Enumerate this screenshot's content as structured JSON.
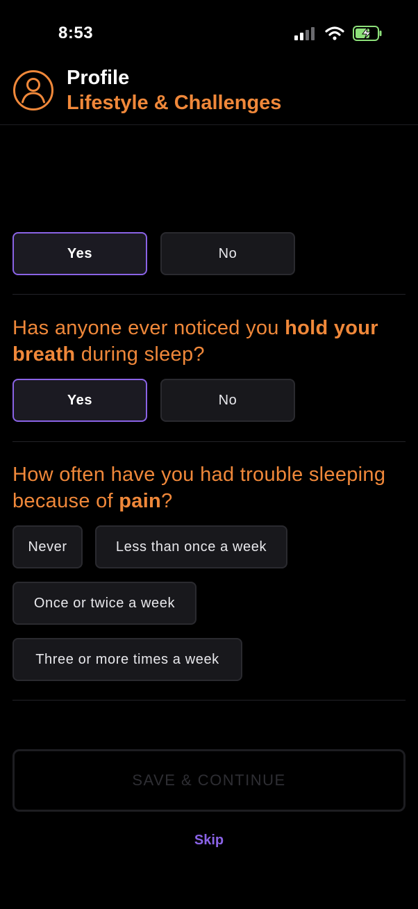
{
  "status_bar": {
    "time": "8:53"
  },
  "header": {
    "title": "Profile",
    "subtitle": "Lifestyle & Challenges"
  },
  "questions": [
    {
      "options": [
        {
          "label": "Yes",
          "selected": true
        },
        {
          "label": "No",
          "selected": false
        }
      ]
    },
    {
      "text_before": "Has anyone ever noticed you ",
      "text_bold": "hold your breath",
      "text_after": " during sleep?",
      "options": [
        {
          "label": "Yes",
          "selected": true
        },
        {
          "label": "No",
          "selected": false
        }
      ]
    },
    {
      "text_before": "How often have you had trouble sleeping because of ",
      "text_bold": "pain",
      "text_after": "?",
      "options": [
        {
          "label": "Never",
          "selected": false
        },
        {
          "label": "Less than once a week",
          "selected": false
        },
        {
          "label": "Once or twice a week",
          "selected": false
        },
        {
          "label": "Three or more times a week",
          "selected": false
        }
      ]
    }
  ],
  "footer": {
    "save_label": "SAVE & CONTINUE",
    "skip_label": "Skip"
  },
  "colors": {
    "accent": "#f0883a",
    "selection": "#8a63e6",
    "background": "#000000"
  }
}
